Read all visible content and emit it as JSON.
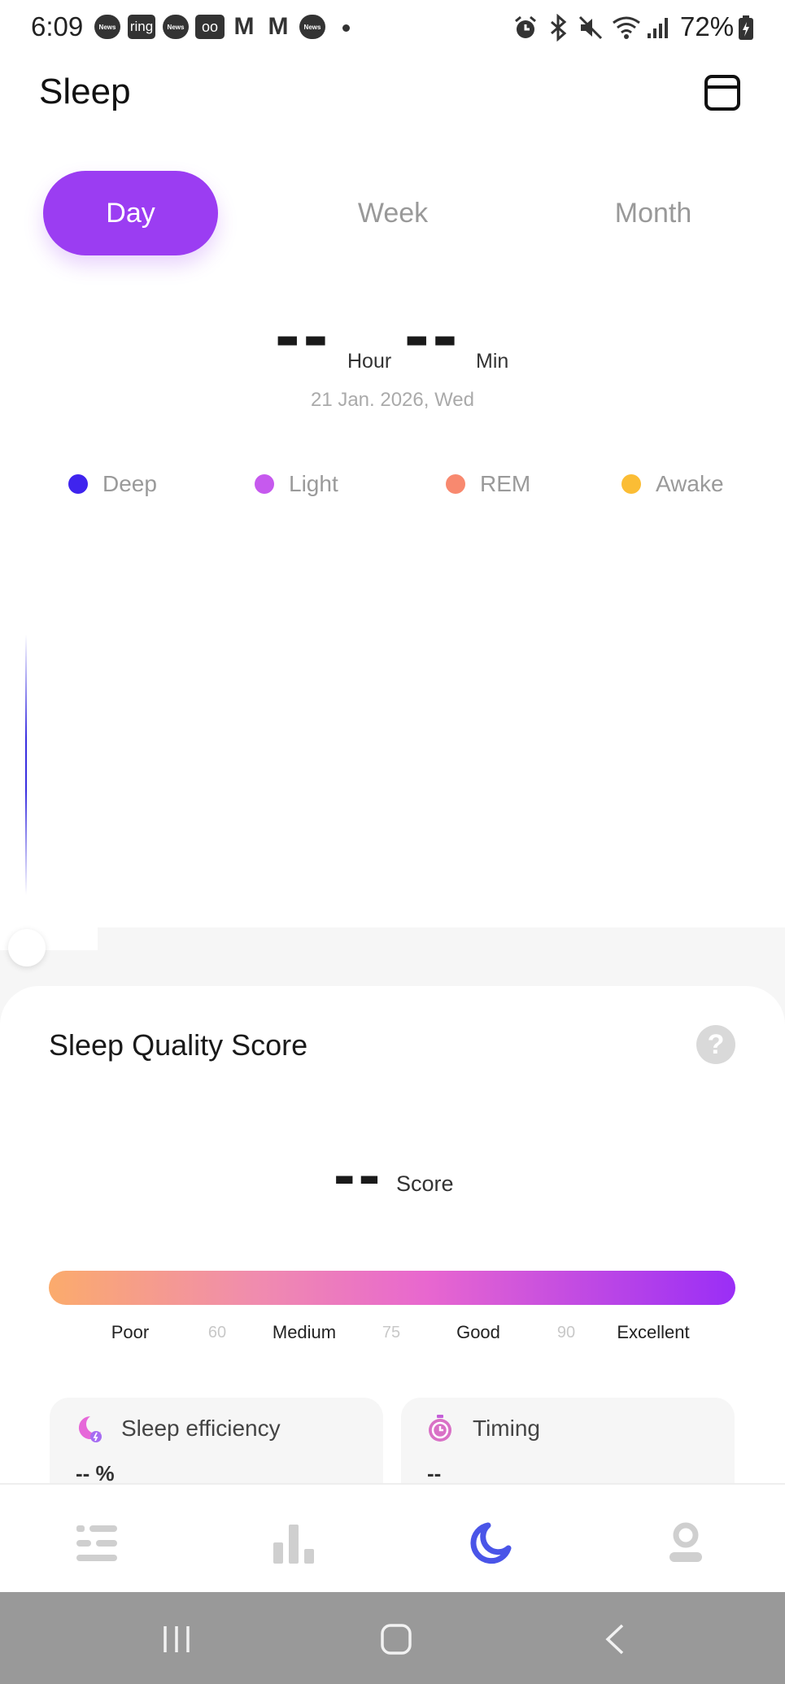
{
  "status_bar": {
    "time": "6:09",
    "battery": "72%",
    "notifications": [
      {
        "name": "news-icon",
        "label": "News"
      },
      {
        "name": "ring-icon",
        "label": "ring"
      },
      {
        "name": "news-icon",
        "label": "News"
      },
      {
        "name": "voicemail-icon",
        "label": "oo"
      },
      {
        "name": "gmail-icon",
        "label": "M"
      },
      {
        "name": "gmail-icon",
        "label": "M"
      },
      {
        "name": "news-icon",
        "label": "News"
      }
    ]
  },
  "header": {
    "title": "Sleep"
  },
  "tabs": [
    {
      "label": "Day",
      "active": true
    },
    {
      "label": "Week",
      "active": false
    },
    {
      "label": "Month",
      "active": false
    }
  ],
  "duration": {
    "hours": "--",
    "hour_unit": "Hour",
    "minutes": "--",
    "minute_unit": "Min",
    "date": "21 Jan. 2026, Wed"
  },
  "legend": [
    {
      "label": "Deep",
      "color": "#3f24ee"
    },
    {
      "label": "Light",
      "color": "#c659ee"
    },
    {
      "label": "REM",
      "color": "#f8896f"
    },
    {
      "label": "Awake",
      "color": "#fbbd35"
    }
  ],
  "score": {
    "title": "Sleep Quality Score",
    "help": "?",
    "value": "--",
    "unit": "Score",
    "scale": [
      {
        "label": "Poor",
        "threshold": "60"
      },
      {
        "label": "Medium",
        "threshold": "75"
      },
      {
        "label": "Good",
        "threshold": "90"
      },
      {
        "label": "Excellent"
      }
    ],
    "gradient": [
      "#fbab6c",
      "#9a2ef6"
    ]
  },
  "metrics": [
    {
      "label": "Sleep efficiency",
      "value": "-- %",
      "icon": "sleep-efficiency-icon"
    },
    {
      "label": "Timing",
      "value": "--",
      "icon": "stopwatch-icon"
    }
  ],
  "accent_color": "#9b3df2",
  "nav": {
    "items": [
      {
        "icon": "list-icon",
        "active": false
      },
      {
        "icon": "bar-chart-icon",
        "active": false
      },
      {
        "icon": "moon-icon",
        "active": true
      },
      {
        "icon": "profile-icon",
        "active": false
      }
    ],
    "active_color": "#4a55e8"
  }
}
